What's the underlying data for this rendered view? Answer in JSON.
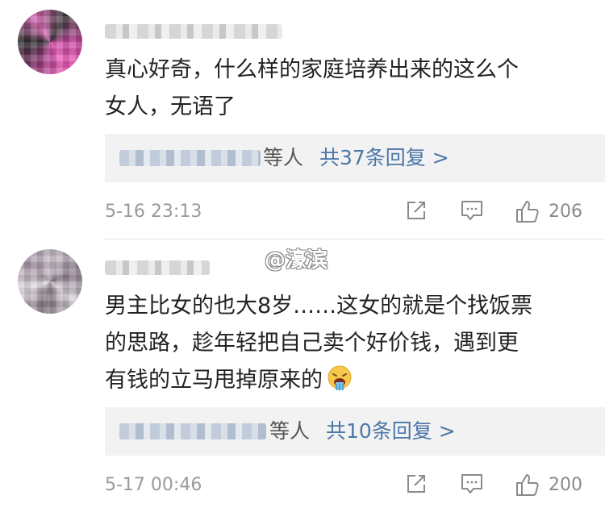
{
  "watermark": "@濠滨",
  "comments": [
    {
      "text": "真心好奇，什么样的家庭培养出来的这么个\n女人，无语了",
      "reply_suffix": "等人",
      "reply_count": "共37条回复 >",
      "timestamp": "5-16 23:13",
      "likes": "206"
    },
    {
      "text": "男主比女的也大8岁……这女的就是个找饭票\n的思路，趁年轻把自己卖个好价钱，遇到更\n有钱的立马甩掉原来的",
      "emoji_icon": "vomit-emoji",
      "reply_suffix": "等人",
      "reply_count": "共10条回复 >",
      "timestamp": "5-17 00:46",
      "likes": "200"
    }
  ]
}
